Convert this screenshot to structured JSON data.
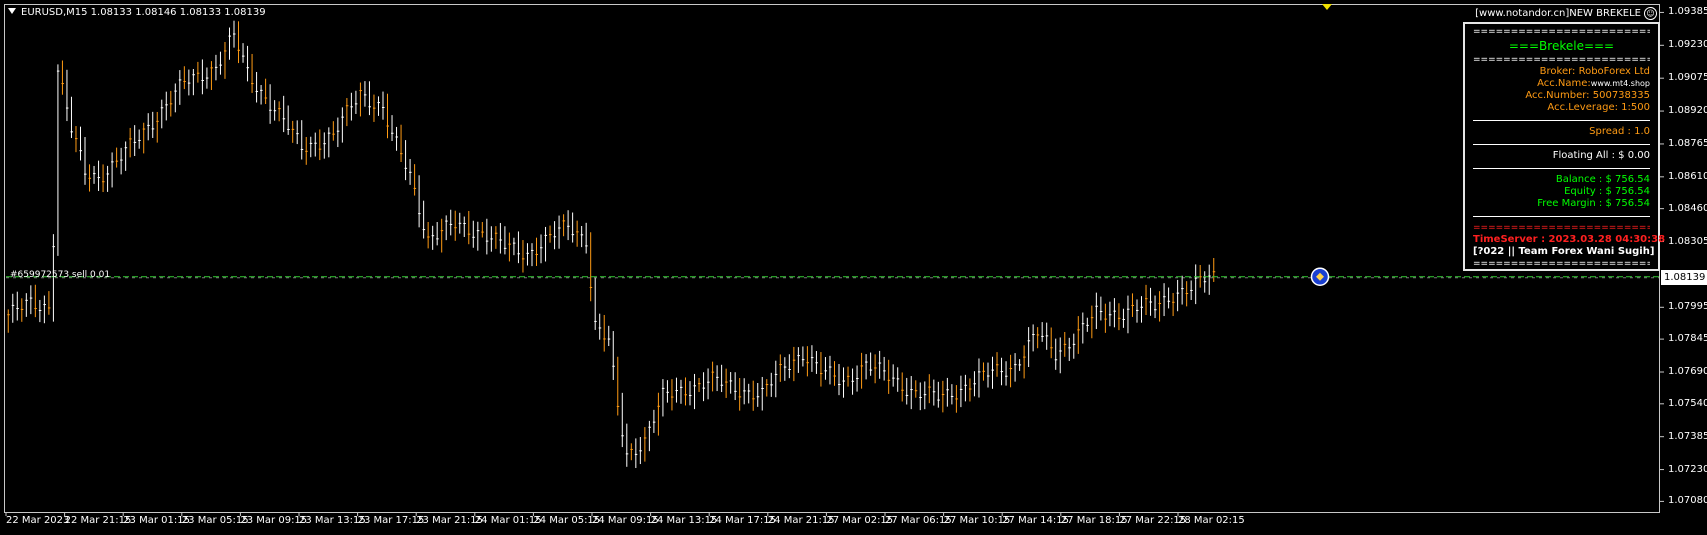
{
  "header": {
    "title": "EURUSD,M15  1.08133 1.08146 1.08133 1.08139",
    "website": "[www.notandor.cn]NEW BREKELE"
  },
  "order_label": "#659972573 sell 0.01",
  "y_axis": {
    "labels": [
      "1.09385",
      "1.09230",
      "1.09075",
      "1.08920",
      "1.08765",
      "1.08610",
      "1.08460",
      "1.08305",
      "1.07995",
      "1.07845",
      "1.07690",
      "1.07540",
      "1.07385",
      "1.07230",
      "1.07080"
    ],
    "current_price": "1.08139",
    "range": [
      1.0703,
      1.0942
    ]
  },
  "x_axis": {
    "labels": [
      "22 Mar 2023",
      "22 Mar 21:15",
      "23 Mar 01:15",
      "23 Mar 05:15",
      "23 Mar 09:15",
      "23 Mar 13:15",
      "23 Mar 17:15",
      "23 Mar 21:15",
      "24 Mar 01:15",
      "24 Mar 05:15",
      "24 Mar 09:15",
      "24 Mar 13:15",
      "24 Mar 17:15",
      "24 Mar 21:15",
      "27 Mar 02:15",
      "27 Mar 06:15",
      "27 Mar 10:15",
      "27 Mar 14:15",
      "27 Mar 18:15",
      "27 Mar 22:15",
      "28 Mar 02:15"
    ]
  },
  "panel": {
    "sep": "==========================",
    "title": "===Brekele===",
    "broker": "Broker: RoboForex Ltd",
    "acc_name_label": "Acc.Name:",
    "acc_name_value": "www.mt4.shop",
    "acc_number": "Acc.Number: 500738335",
    "acc_leverage": "Acc.Leverage: 1:500",
    "spread": "Spread :  1.0",
    "floating": "Floating All  : $ 0.00",
    "balance": "Balance  : $ 756.54",
    "equity": "Equity  : $ 756.54",
    "free_margin": "Free Margin : $ 756.54",
    "time_server": "TimeServer : 2023.03.28 04:30:38",
    "team": "[?022 || Team Forex Wani Sugih]"
  },
  "colors": {
    "background": "#000000",
    "candle": "#ffffff",
    "candle_alt": "#ff9b14",
    "order_line": "#33cc33",
    "price_line": "#c8c8c8"
  },
  "chart_data": {
    "type": "candlestick",
    "symbol": "EURUSD",
    "timeframe": "M15",
    "close_path": [
      [
        0,
        1.0796
      ],
      [
        5,
        1.0801
      ],
      [
        9,
        1.08
      ],
      [
        10,
        1.0832
      ],
      [
        11,
        1.0912
      ],
      [
        14,
        1.0883
      ],
      [
        17,
        1.0863
      ],
      [
        20,
        1.0861
      ],
      [
        24,
        1.0868
      ],
      [
        28,
        1.0877
      ],
      [
        33,
        1.089
      ],
      [
        39,
        1.0905
      ],
      [
        46,
        1.0913
      ],
      [
        50,
        1.0927
      ],
      [
        53,
        1.091
      ],
      [
        59,
        1.0893
      ],
      [
        65,
        1.0875
      ],
      [
        72,
        1.088
      ],
      [
        78,
        1.0901
      ],
      [
        83,
        1.0893
      ],
      [
        85,
        1.088
      ],
      [
        89,
        1.0862
      ],
      [
        93,
        1.0832
      ],
      [
        99,
        1.0838
      ],
      [
        105,
        1.0835
      ],
      [
        110,
        1.0828
      ],
      [
        115,
        1.0825
      ],
      [
        120,
        1.0832
      ],
      [
        124,
        1.0838
      ],
      [
        128,
        1.0832
      ],
      [
        130,
        1.0791
      ],
      [
        133,
        1.0783
      ],
      [
        135,
        1.0752
      ],
      [
        137,
        1.073
      ],
      [
        141,
        1.0737
      ],
      [
        145,
        1.0757
      ],
      [
        150,
        1.0761
      ],
      [
        156,
        1.0765
      ],
      [
        162,
        1.0761
      ],
      [
        167,
        1.0758
      ],
      [
        172,
        1.0772
      ],
      [
        176,
        1.0778
      ],
      [
        180,
        1.0769
      ],
      [
        185,
        1.0765
      ],
      [
        190,
        1.0772
      ],
      [
        196,
        1.0766
      ],
      [
        201,
        1.0759
      ],
      [
        206,
        1.0757
      ],
      [
        212,
        1.0762
      ],
      [
        218,
        1.0769
      ],
      [
        223,
        1.0772
      ],
      [
        228,
        1.0787
      ],
      [
        232,
        1.0778
      ],
      [
        236,
        1.0785
      ],
      [
        241,
        1.0796
      ],
      [
        246,
        1.0797
      ],
      [
        250,
        1.0799
      ],
      [
        254,
        1.08
      ],
      [
        258,
        1.0806
      ],
      [
        262,
        1.0808
      ],
      [
        266,
        1.0814
      ]
    ],
    "total_bars": 268
  }
}
